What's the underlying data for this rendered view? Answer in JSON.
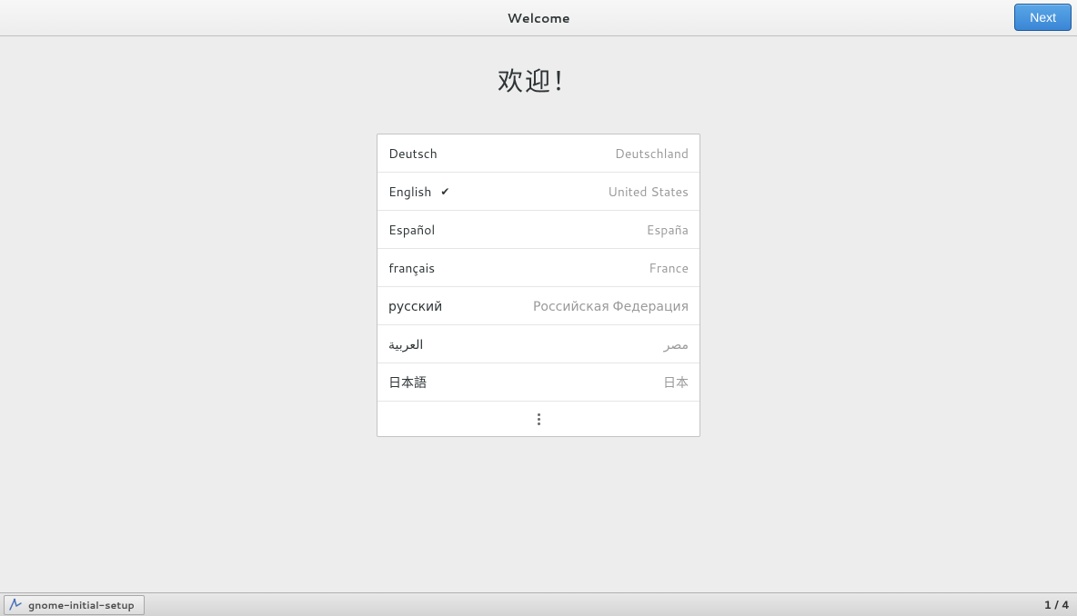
{
  "header": {
    "title": "Welcome",
    "next_label": "Next"
  },
  "main": {
    "heading": "欢迎！"
  },
  "languages": [
    {
      "name": "Deutsch",
      "country": "Deutschland",
      "selected": false
    },
    {
      "name": "English",
      "country": "United States",
      "selected": true
    },
    {
      "name": "Español",
      "country": "España",
      "selected": false
    },
    {
      "name": "français",
      "country": "France",
      "selected": false
    },
    {
      "name": "русский",
      "country": "Российская Федерация",
      "selected": false
    },
    {
      "name": "العربية",
      "country": "مصر",
      "selected": false
    },
    {
      "name": "日本語",
      "country": "日本",
      "selected": false
    }
  ],
  "taskbar": {
    "app_label": "gnome-initial-setup",
    "workspace": "1 / 4"
  }
}
